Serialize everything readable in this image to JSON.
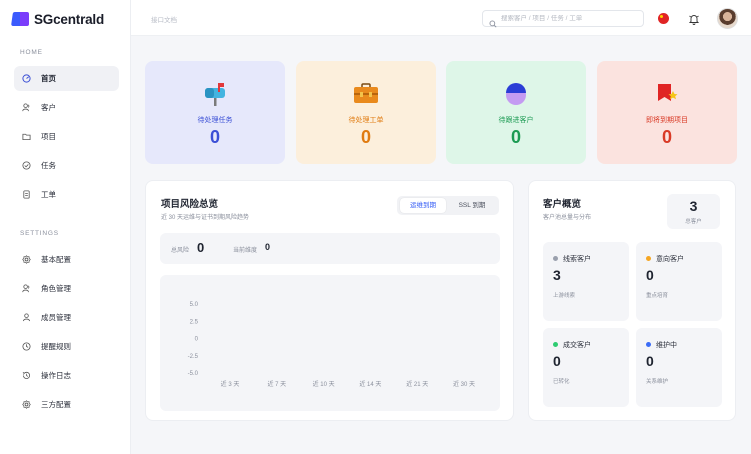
{
  "app": {
    "name": "SGcentrald"
  },
  "header": {
    "title": "接口文档",
    "search_placeholder": "搜索客户 / 项目 / 任务 / 工单"
  },
  "sidebar": {
    "home_label": "HOME",
    "settings_label": "SETTINGS",
    "home_items": [
      {
        "label": "首页",
        "icon": "dashboard-icon",
        "active": true
      },
      {
        "label": "客户",
        "icon": "users-icon"
      },
      {
        "label": "项目",
        "icon": "folder-icon"
      },
      {
        "label": "任务",
        "icon": "check-circle-icon"
      },
      {
        "label": "工单",
        "icon": "document-icon"
      }
    ],
    "settings_items": [
      {
        "label": "基本配置",
        "icon": "gear-icon"
      },
      {
        "label": "角色管理",
        "icon": "users-icon"
      },
      {
        "label": "成员管理",
        "icon": "user-icon"
      },
      {
        "label": "提醒规则",
        "icon": "clock-icon"
      },
      {
        "label": "操作日志",
        "icon": "history-icon"
      },
      {
        "label": "三方配置",
        "icon": "gear-icon"
      }
    ]
  },
  "stats": [
    {
      "label": "待处理任务",
      "value": "0",
      "icon": "mailbox-icon",
      "bg": "#e6e8fb",
      "color": "#3b4fd6"
    },
    {
      "label": "待处理工单",
      "value": "0",
      "icon": "briefcase-icon",
      "bg": "#fcefdc",
      "color": "#e07b11"
    },
    {
      "label": "待跟进客户",
      "value": "0",
      "icon": "person-icon",
      "bg": "#def6e8",
      "color": "#1c9b53"
    },
    {
      "label": "即将到期项目",
      "value": "0",
      "icon": "flag-icon",
      "bg": "#fbe3df",
      "color": "#d93a26"
    }
  ],
  "risk": {
    "title": "项目风险总览",
    "subtitle": "近 30 天运维与证书到期风险趋势",
    "toggle": [
      "运维到期",
      "SSL 到期"
    ],
    "total_label": "总风险",
    "total_value": "0",
    "peak_label": "当前维度",
    "peak_value": "0"
  },
  "chart_data": {
    "type": "line",
    "categories": [
      "近 3 天",
      "近 7 天",
      "近 10 天",
      "近 14 天",
      "近 21 天",
      "近 30 天"
    ],
    "y_ticks": [
      "5.0",
      "2.5",
      "0",
      "-2.5",
      "-5.0"
    ],
    "ylim": [
      -5,
      5
    ],
    "series": []
  },
  "customers": {
    "title": "客户概览",
    "subtitle": "客户池总量与分布",
    "total_value": "3",
    "total_label": "总客户",
    "cards": [
      {
        "label": "线索客户",
        "value": "3",
        "sub": "上游线索",
        "color": "#9aa0ad"
      },
      {
        "label": "意向客户",
        "value": "0",
        "sub": "重点培育",
        "color": "#f5a623"
      },
      {
        "label": "成交客户",
        "value": "0",
        "sub": "已转化",
        "color": "#2ecc71"
      },
      {
        "label": "维护中",
        "value": "0",
        "sub": "关系维护",
        "color": "#3b6cf6"
      }
    ]
  }
}
